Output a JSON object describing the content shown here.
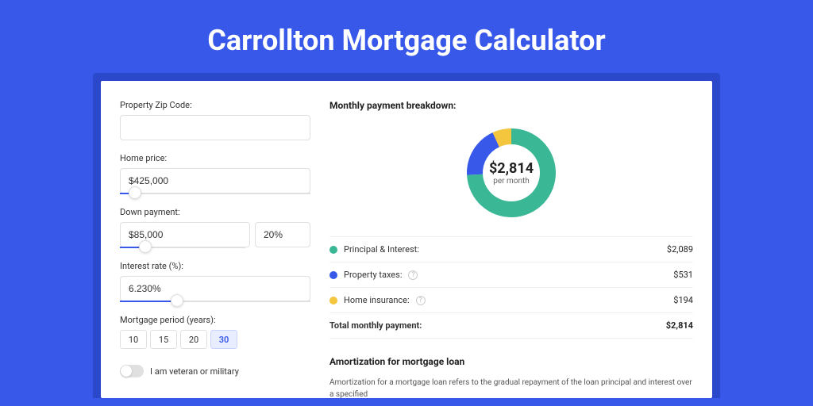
{
  "title": "Carrollton Mortgage Calculator",
  "form": {
    "zip": {
      "label": "Property Zip Code:",
      "value": ""
    },
    "price": {
      "label": "Home price:",
      "value": "$425,000",
      "slider_pct": 8
    },
    "down": {
      "label": "Down payment:",
      "value": "$85,000",
      "pct_value": "20%",
      "slider_pct": 20
    },
    "rate": {
      "label": "Interest rate (%):",
      "value": "6.230%",
      "slider_pct": 30
    },
    "period": {
      "label": "Mortgage period (years):",
      "options": [
        "10",
        "15",
        "20",
        "30"
      ],
      "selected": "30"
    },
    "veteran": {
      "label": "I am veteran or military"
    }
  },
  "breakdown": {
    "title": "Monthly payment breakdown:",
    "donut": {
      "value": "$2,814",
      "sub": "per month"
    },
    "items": [
      {
        "color": "#3ab795",
        "label": "Principal & Interest:",
        "value": "$2,089",
        "help": false
      },
      {
        "color": "#3858e9",
        "label": "Property taxes:",
        "value": "$531",
        "help": true
      },
      {
        "color": "#f4c63d",
        "label": "Home insurance:",
        "value": "$194",
        "help": true
      }
    ],
    "total": {
      "label": "Total monthly payment:",
      "value": "$2,814"
    }
  },
  "amort": {
    "title": "Amortization for mortgage loan",
    "body": "Amortization for a mortgage loan refers to the gradual repayment of the loan principal and interest over a specified"
  },
  "chart_data": {
    "type": "pie",
    "title": "Monthly payment breakdown",
    "series": [
      {
        "name": "Principal & Interest",
        "value": 2089,
        "color": "#3ab795"
      },
      {
        "name": "Property taxes",
        "value": 531,
        "color": "#3858e9"
      },
      {
        "name": "Home insurance",
        "value": 194,
        "color": "#f4c63d"
      }
    ],
    "total": 2814,
    "center_label": "$2,814",
    "center_sub": "per month"
  }
}
